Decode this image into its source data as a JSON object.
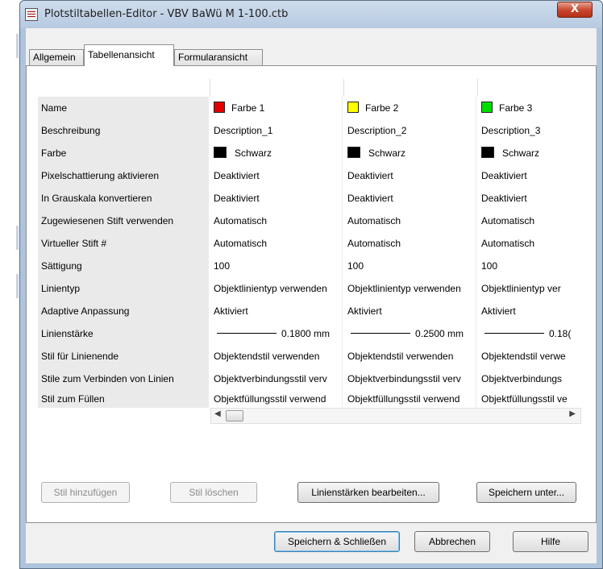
{
  "window": {
    "title": "Plotstiltabellen-Editor - VBV BaWü M 1-100.ctb",
    "close_glyph": "X"
  },
  "tabs": [
    {
      "label": "Allgemein"
    },
    {
      "label": "Tabellenansicht"
    },
    {
      "label": "Formularansicht"
    }
  ],
  "table": {
    "styles": [
      {
        "name": "Farbe 1",
        "color": "#e00000"
      },
      {
        "name": "Farbe 2",
        "color": "#ffff00"
      },
      {
        "name": "Farbe 3",
        "color": "#00dd00"
      }
    ],
    "rows": [
      {
        "label": "Name",
        "values": [
          "Farbe 1",
          "Farbe 2",
          "Farbe 3"
        ]
      },
      {
        "label": "Beschreibung",
        "values": [
          "Description_1",
          "Description_2",
          "Description_3"
        ]
      },
      {
        "label": "Farbe",
        "values": [
          "Schwarz",
          "Schwarz",
          "Schwarz"
        ]
      },
      {
        "label": "Pixelschattierung aktivieren",
        "values": [
          "Deaktiviert",
          "Deaktiviert",
          "Deaktiviert"
        ]
      },
      {
        "label": "In Grauskala konvertieren",
        "values": [
          "Deaktiviert",
          "Deaktiviert",
          "Deaktiviert"
        ]
      },
      {
        "label": "Zugewiesenen Stift verwenden",
        "values": [
          "Automatisch",
          "Automatisch",
          "Automatisch"
        ]
      },
      {
        "label": "Virtueller Stift #",
        "values": [
          "Automatisch",
          "Automatisch",
          "Automatisch"
        ]
      },
      {
        "label": "Sättigung",
        "values": [
          "100",
          "100",
          "100"
        ]
      },
      {
        "label": "Linientyp",
        "values": [
          "Objektlinientyp verwenden",
          "Objektlinientyp verwenden",
          "Objektlinientyp ver"
        ]
      },
      {
        "label": "Adaptive Anpassung",
        "values": [
          "Aktiviert",
          "Aktiviert",
          "Aktiviert"
        ]
      },
      {
        "label": "Linienstärke",
        "values": [
          "0.1800 mm",
          "0.2500 mm",
          "0.18("
        ]
      },
      {
        "label": "Stil für Linienende",
        "values": [
          "Objektendstil verwenden",
          "Objektendstil verwenden",
          "Objektendstil verwe"
        ]
      },
      {
        "label": "Stile zum Verbinden von Linien",
        "values": [
          "Objektverbindungsstil verv",
          "Objektverbindungsstil verv",
          "Objektverbindungs"
        ]
      },
      {
        "label": "Stil zum Füllen",
        "values": [
          "Objektfüllungsstil verwend",
          "Objektfüllungsstil verwend",
          "Objektfüllungsstil ve"
        ]
      }
    ],
    "fill_color_swatch": "#000000"
  },
  "panel_buttons": {
    "add_style": "Stil hinzufügen",
    "delete_style": "Stil löschen",
    "edit_lineweights": "Linienstärken bearbeiten...",
    "save_as": "Speichern unter..."
  },
  "dialog_buttons": {
    "save_close": "Speichern & Schließen",
    "cancel": "Abbrechen",
    "help": "Hilfe"
  }
}
